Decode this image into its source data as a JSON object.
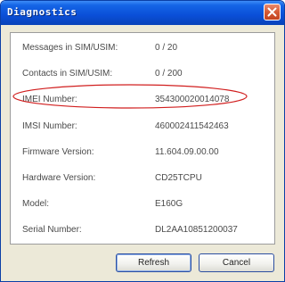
{
  "window": {
    "title": "Diagnostics"
  },
  "rows": [
    {
      "label": "Messages in SIM/USIM:",
      "value": "0 / 20"
    },
    {
      "label": "Contacts in SIM/USIM:",
      "value": "0 / 200"
    },
    {
      "label": "IMEI Number:",
      "value": "354300020014078"
    },
    {
      "label": "IMSI Number:",
      "value": "460002411542463"
    },
    {
      "label": "Firmware Version:",
      "value": "11.604.09.00.00"
    },
    {
      "label": "Hardware Version:",
      "value": "CD25TCPU"
    },
    {
      "label": "Model:",
      "value": "E160G"
    },
    {
      "label": "Serial Number:",
      "value": "DL2AA10851200037"
    }
  ],
  "buttons": {
    "refresh": "Refresh",
    "cancel": "Cancel"
  },
  "colors": {
    "title_bar": "#0a4fd8",
    "highlight_ellipse": "#d11f1f",
    "close_button": "#d55a35"
  },
  "icons": {
    "close": "close-icon"
  }
}
